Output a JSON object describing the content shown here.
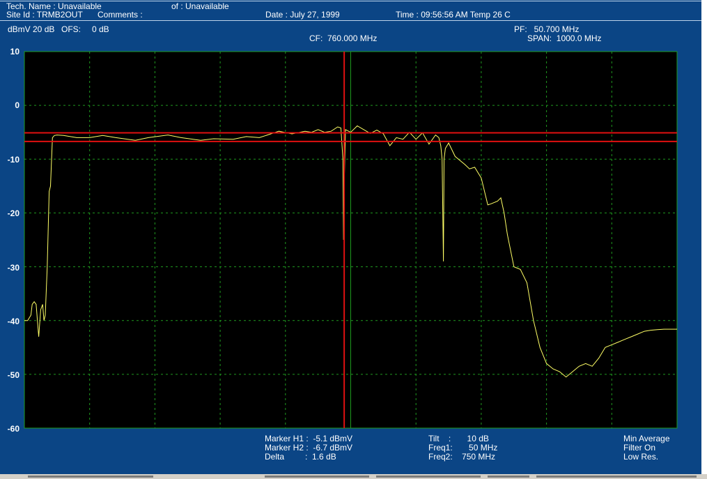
{
  "header": {
    "tech_name": "Tech. Name : Unavailable",
    "of": "of : Unavailable",
    "site_id": "Site Id : TRMB2OUT",
    "comments": "Comments :",
    "date": "Date : July 27, 1999",
    "time_temp": "Time : 09:56:56 AM Temp 26 C"
  },
  "settings": {
    "ref": "dBmV 20 dB",
    "ofs": "OFS:",
    "ofs_value": "0 dB",
    "cf": "CF:  760.000 MHz",
    "pf": "PF:   50.700 MHz",
    "span": "SPAN:  1000.0 MHz"
  },
  "footer": {
    "marker_h1": "Marker H1 :  -5.1 dBmV",
    "marker_h2": "Marker H2 :  -6.7 dBmV",
    "delta": "Delta         :  1.6 dB",
    "tilt": "Tilt    :       10 dB",
    "freq1": "Freq1:       50 MHz",
    "freq2": "Freq2:    750 MHz",
    "mode1": "Min Average",
    "mode2": "Filter On",
    "mode3": "Low Res."
  },
  "colors": {
    "background": "#0b4585",
    "plot_bg": "#000000",
    "grid": "#1f9a1f",
    "trace": "#ffff66",
    "marker": "#e01010"
  },
  "chart_data": {
    "type": "line",
    "title": "",
    "xlabel": "",
    "ylabel": "",
    "xlim": [
      260,
      1260
    ],
    "ylim": [
      -60,
      10
    ],
    "yticks": [
      10,
      0,
      -10,
      -20,
      -30,
      -40,
      -50,
      -60
    ],
    "center_frequency_mhz": 760,
    "grid": true,
    "series": [
      {
        "x": [
          260,
          265,
          270,
          272,
          275,
          278,
          280,
          282,
          285,
          288,
          290,
          292,
          295,
          298,
          300,
          303,
          306,
          310,
          320,
          340,
          360,
          380,
          400,
          430,
          450,
          480,
          500,
          530,
          550,
          580,
          600,
          620,
          650,
          670,
          690,
          700,
          710,
          720,
          730,
          740,
          745,
          748,
          749,
          750,
          752,
          760,
          770,
          780,
          790,
          800,
          810,
          820,
          830,
          840,
          850,
          860,
          870,
          880,
          890,
          895,
          898,
          900,
          902,
          903,
          905,
          910,
          920,
          935,
          942,
          950,
          960,
          970,
          975,
          985,
          990,
          995,
          1000,
          1010,
          1020,
          1030,
          1040,
          1050,
          1060,
          1070,
          1080,
          1090,
          1100,
          1110,
          1120,
          1130,
          1140,
          1150,
          1160,
          1170,
          1180,
          1190,
          1200,
          1210,
          1220,
          1230,
          1240,
          1250,
          1255,
          1260
        ],
        "y": [
          -40,
          -40,
          -39,
          -37,
          -36.5,
          -37,
          -40,
          -43,
          -38,
          -37,
          -40,
          -39,
          -30,
          -16,
          -15,
          -6,
          -5.6,
          -5.5,
          -5.6,
          -6,
          -6,
          -5.6,
          -6,
          -6.5,
          -6,
          -5.5,
          -6,
          -6.5,
          -6.2,
          -6.3,
          -5.8,
          -6,
          -4.8,
          -5.3,
          -4.8,
          -5,
          -4.5,
          -5,
          -4.8,
          -4,
          -4.2,
          -10,
          -25,
          -15,
          -4.5,
          -5,
          -3.8,
          -4.5,
          -5.2,
          -4.6,
          -5.3,
          -7.5,
          -6,
          -6.3,
          -5,
          -6.3,
          -5.1,
          -7.2,
          -5.5,
          -6,
          -7.5,
          -10,
          -29,
          -10,
          -8,
          -7,
          -9.5,
          -11,
          -11.8,
          -11.5,
          -13.5,
          -18.5,
          -18.3,
          -17.8,
          -17.2,
          -20,
          -24,
          -30,
          -30.5,
          -33,
          -40,
          -45,
          -48,
          -49,
          -49.5,
          -50.5,
          -49.5,
          -48.5,
          -48,
          -48.5,
          -47,
          -45,
          -44.5,
          -44,
          -43.5,
          -43,
          -42.5,
          -42,
          -41.8,
          -41.7,
          -41.6,
          -41.6,
          -41.6,
          -41.6
        ]
      }
    ],
    "markers": {
      "h1_dbmv": -5.1,
      "h2_dbmv": -6.7,
      "cursor_freq_mhz": 750
    }
  }
}
